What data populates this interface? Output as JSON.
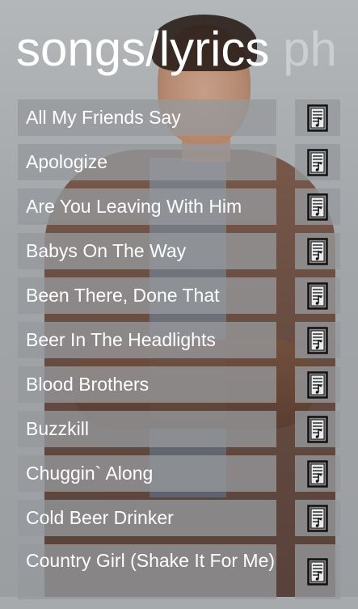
{
  "header": {
    "title": "songs/lyrics",
    "next_pivot": "ph"
  },
  "songs": [
    {
      "title": "All My Friends Say",
      "icon": "lyrics-document-icon"
    },
    {
      "title": "Apologize",
      "icon": "lyrics-document-icon"
    },
    {
      "title": "Are You Leaving With Him",
      "icon": "lyrics-document-icon"
    },
    {
      "title": "Babys On The Way",
      "icon": "lyrics-document-icon"
    },
    {
      "title": "Been There, Done That",
      "icon": "lyrics-document-icon"
    },
    {
      "title": "Beer In The Headlights",
      "icon": "lyrics-document-icon"
    },
    {
      "title": "Blood Brothers",
      "icon": "lyrics-document-icon"
    },
    {
      "title": "Buzzkill",
      "icon": "lyrics-document-icon"
    },
    {
      "title": "Chuggin` Along",
      "icon": "lyrics-document-icon"
    },
    {
      "title": "Cold Beer Drinker",
      "icon": "lyrics-document-icon"
    },
    {
      "title": "Country Girl (Shake It For Me)",
      "icon": "lyrics-document-icon"
    }
  ],
  "colors": {
    "tile": "#96999c",
    "text": "#ffffff",
    "background": "#a7aaad"
  }
}
